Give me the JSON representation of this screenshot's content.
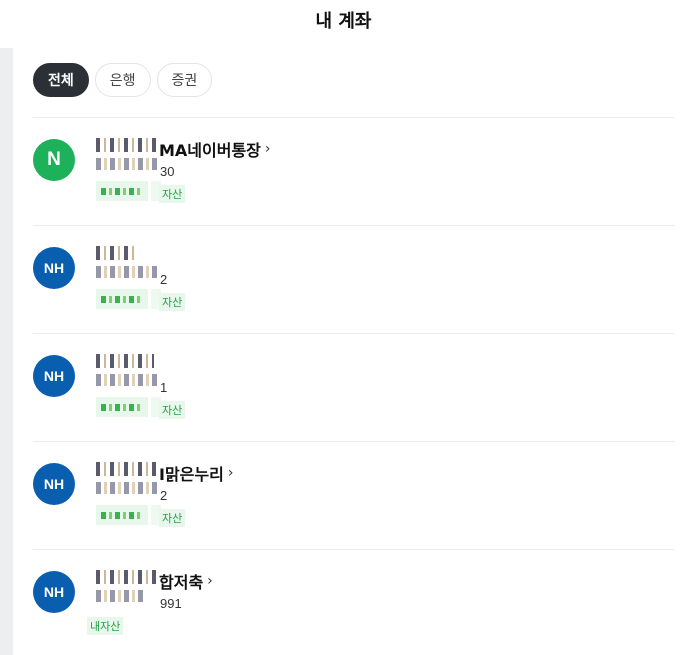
{
  "header": {
    "title": "내 계좌"
  },
  "tabs": [
    {
      "label": "전체",
      "active": true
    },
    {
      "label": "은행",
      "active": false
    },
    {
      "label": "증권",
      "active": false
    }
  ],
  "accounts": [
    {
      "logo": "N",
      "logo_color": "#1db15a",
      "title": "MA네이버통장",
      "number_suffix": "30",
      "badge": "자산",
      "has_chevron": true
    },
    {
      "logo": "NH",
      "logo_color": "#0a5eb0",
      "title": "",
      "number_suffix": "2",
      "badge": "자산",
      "has_chevron": false
    },
    {
      "logo": "NH",
      "logo_color": "#0a5eb0",
      "title": "",
      "number_suffix": "1",
      "badge": "자산",
      "has_chevron": false
    },
    {
      "logo": "NH",
      "logo_color": "#0a5eb0",
      "title": "I맑은누리",
      "number_suffix": "2",
      "badge": "자산",
      "has_chevron": true
    },
    {
      "logo": "NH",
      "logo_color": "#0a5eb0",
      "title": "합저축",
      "number_suffix": "991",
      "badge": "내자산",
      "has_chevron": true
    }
  ],
  "icons": {
    "chevron": "›"
  },
  "colors": {
    "accent_green": "#24a146",
    "active_tab": "#2b3036",
    "naver_green": "#1db15a",
    "nh_blue": "#0a5eb0"
  }
}
